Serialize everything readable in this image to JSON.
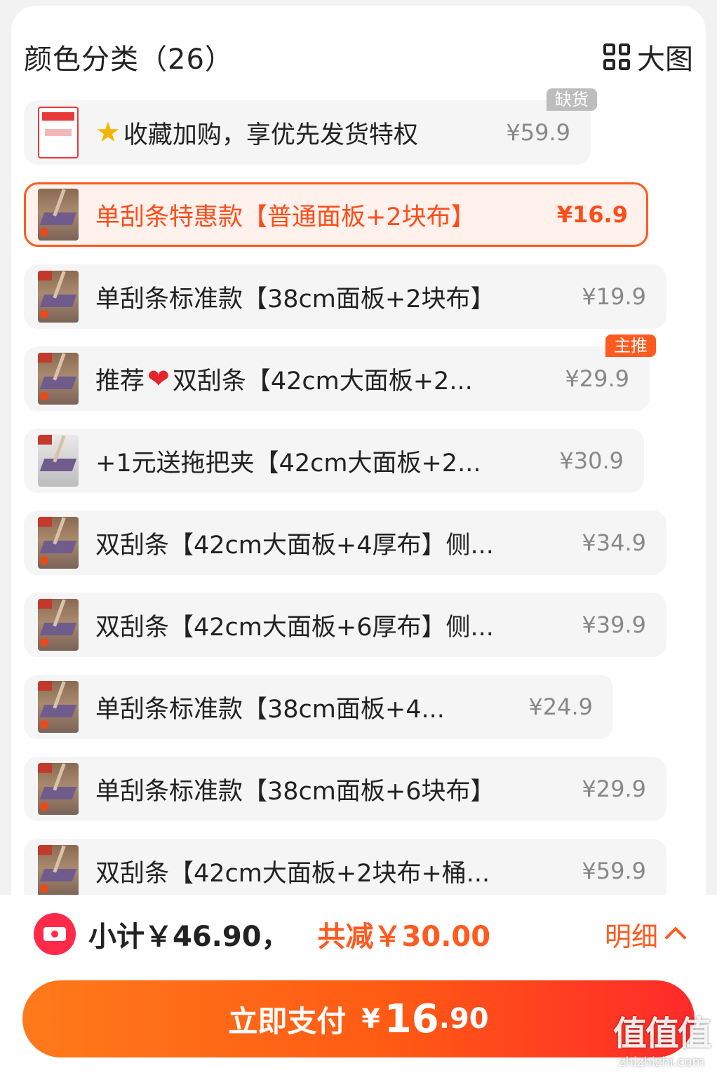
{
  "header": {
    "title": "颜色分类（26）",
    "big_view_label": "大图"
  },
  "items": [
    {
      "label": "收藏加购，享优先发货特权",
      "price": "¥59.9",
      "tag": "缺货",
      "icon": "star-icon"
    },
    {
      "label": "单刮条特惠款【普通面板+2块布】",
      "price": "¥16.9",
      "selected": true
    },
    {
      "label": "单刮条标准款【38cm面板+2块布】",
      "price": "¥19.9"
    },
    {
      "label_pre": "推荐",
      "label_post": "双刮条【42cm大面板+2...",
      "price": "¥29.9",
      "tag": "主推",
      "icon": "heart-icon"
    },
    {
      "label": "+1元送拖把夹【42cm大面板+2...",
      "price": "¥30.9"
    },
    {
      "label": "双刮条【42cm大面板+4厚布】侧...",
      "price": "¥34.9"
    },
    {
      "label": "双刮条【42cm大面板+6厚布】侧...",
      "price": "¥39.9"
    },
    {
      "label": "单刮条标准款【38cm面板+4...",
      "price": "¥24.9"
    },
    {
      "label": "单刮条标准款【38cm面板+6块布】",
      "price": "¥29.9"
    },
    {
      "label": "双刮条【42cm大面板+2块布+桶...",
      "price": "¥59.9"
    }
  ],
  "footer": {
    "subtotal": "小计￥46.90，",
    "discount": "共减￥30.00",
    "detail_label": "明细",
    "pay_label": "立即支付",
    "pay_currency": "¥",
    "pay_integer": "16",
    "pay_decimal": ".90"
  },
  "watermark": {
    "logo": "值值值",
    "url": "zhizhizhi.com"
  },
  "colors": {
    "accent": "#ff5a1f",
    "selected_bg": "#fff2ec",
    "pay_gradient_start": "#ff7a1a",
    "pay_gradient_end": "#ff2a2a"
  }
}
